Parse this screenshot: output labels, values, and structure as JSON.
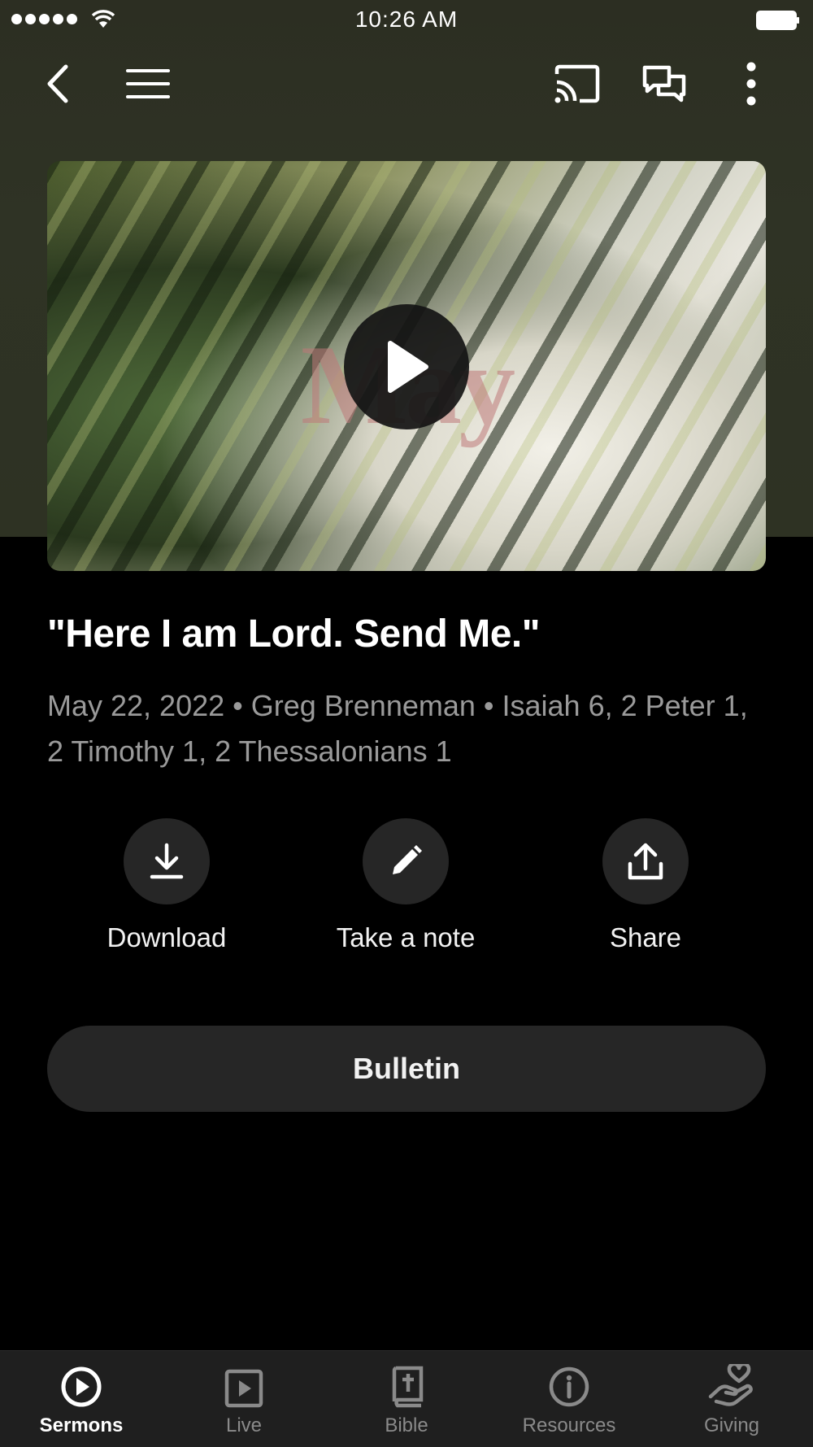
{
  "status_bar": {
    "time": "10:26 AM"
  },
  "video": {
    "title_art_text": "May"
  },
  "sermon": {
    "title": "\"Here I am Lord. Send Me.\"",
    "meta": "May 22, 2022 • Greg Brenneman • Isaiah 6, 2 Peter 1, 2 Timothy 1, 2 Thessalonians 1"
  },
  "actions": [
    {
      "label": "Download",
      "icon": "download-icon"
    },
    {
      "label": "Take a note",
      "icon": "pencil-icon"
    },
    {
      "label": "Share",
      "icon": "share-icon"
    }
  ],
  "bulletin_label": "Bulletin",
  "tabs": [
    {
      "label": "Sermons",
      "icon": "play-circle-icon",
      "active": true
    },
    {
      "label": "Live",
      "icon": "play-square-icon"
    },
    {
      "label": "Bible",
      "icon": "bible-icon"
    },
    {
      "label": "Resources",
      "icon": "info-icon"
    },
    {
      "label": "Giving",
      "icon": "giving-hand-icon"
    }
  ],
  "colors": {
    "accent": "#ffffff",
    "inactive": "#8a8a8a",
    "surface": "#262626",
    "header_bg": "#2e3223"
  }
}
